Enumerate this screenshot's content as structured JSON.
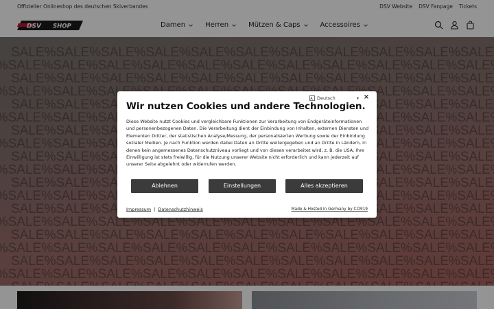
{
  "topbar": {
    "announcement": "Offizieller Onlineshop des deutschen Skiverbandes",
    "links": [
      "DSV Website",
      "DSV Fanpage",
      "Tickets"
    ]
  },
  "header": {
    "logo_text": "DSV",
    "logo_shop": "SHOP",
    "nav": [
      {
        "label": "Damen"
      },
      {
        "label": "Herren"
      },
      {
        "label": "Mützen & Caps"
      },
      {
        "label": "Accessoires"
      }
    ],
    "icons": [
      "search-icon",
      "account-icon",
      "cart-icon"
    ]
  },
  "hero": {
    "pattern_word": "SALE",
    "pattern_symbol": "%"
  },
  "cookie_modal": {
    "language": "Deutsch",
    "close_label": "×",
    "title": "Wir nutzen Cookies und andere Technologien.",
    "body": "Diese Website nutzt Cookies und vergleichbare Funktionen zur Verarbeitung von Endgeräteinformationen und personenbezogenen Daten. Die Verarbeitung dient der Einbindung von Inhalten, externen Diensten und Elementen Dritter, der statistischen Analyse/Messung, der personalisierten Werbung sowie der Einbindung sozialer Medien. Je nach Funktion werden dabei Daten an Dritte weitergegeben und an Dritte in Ländern, in denen kein angemessenes Datenschutzniveau vorliegt und von diesen verarbeitet wird, z. B. die USA. Ihre Einwilligung ist stets freiwillig, für die Nutzung unserer Website nicht erforderlich und kann jederzeit auf unserer Seite abgelehnt oder widerrufen werden.",
    "buttons": {
      "reject": "Ablehnen",
      "settings": "Einstellungen",
      "accept_all": "Alles akzeptieren"
    },
    "footer": {
      "imprint": "Impressum",
      "separator": "|",
      "privacy": "Datenschutzhinweis",
      "hosted": "Made & Hosted in Germany by CCM19"
    }
  },
  "colors": {
    "button_bg": "#3b3b3b",
    "overlay": "rgba(0,0,0,0.42)",
    "logo_red": "#c8102e"
  }
}
